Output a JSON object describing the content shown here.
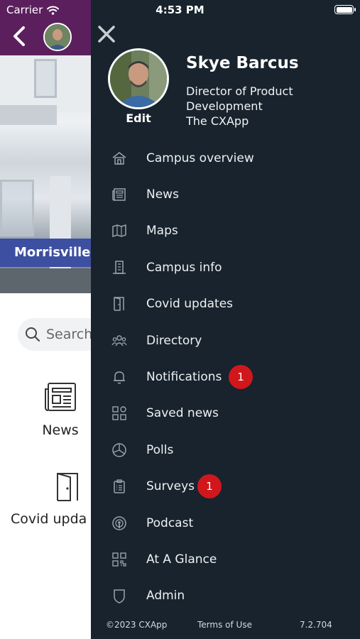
{
  "status_bar": {
    "carrier": "Carrier",
    "time": "4:53 PM"
  },
  "background": {
    "location": "Morrisville,",
    "search_placeholder": "Search",
    "tiles": [
      {
        "label": "News",
        "icon": "newspaper-icon"
      },
      {
        "label": "Covid upda",
        "icon": "door-icon"
      }
    ]
  },
  "profile": {
    "name": "Skye Barcus",
    "title_line1": "Director of Product",
    "title_line2": "Development",
    "company": "The CXApp",
    "edit_label": "Edit"
  },
  "menu": [
    {
      "label": "Campus overview",
      "icon": "home-icon"
    },
    {
      "label": "News",
      "icon": "newspaper-icon"
    },
    {
      "label": "Maps",
      "icon": "map-icon"
    },
    {
      "label": "Campus info",
      "icon": "building-icon"
    },
    {
      "label": "Covid updates",
      "icon": "door-icon"
    },
    {
      "label": "Directory",
      "icon": "people-icon"
    },
    {
      "label": "Notifications",
      "icon": "bell-icon",
      "badge": "1"
    },
    {
      "label": "Saved news",
      "icon": "saved-news-icon"
    },
    {
      "label": "Polls",
      "icon": "pie-chart-icon"
    },
    {
      "label": "Surveys",
      "icon": "clipboard-icon",
      "badge": "1"
    },
    {
      "label": "Podcast",
      "icon": "podcast-icon"
    },
    {
      "label": "At A Glance",
      "icon": "qr-code-icon"
    },
    {
      "label": "Admin",
      "icon": "shield-icon"
    }
  ],
  "footer": {
    "copyright": "©2023 CXApp",
    "terms": "Terms of Use",
    "version": "7.2.704"
  },
  "colors": {
    "drawer_bg": "#18232d",
    "header_purple": "#5b1f5e",
    "badge_red": "#d0171c",
    "banner_blue": "#3d4fa0"
  }
}
